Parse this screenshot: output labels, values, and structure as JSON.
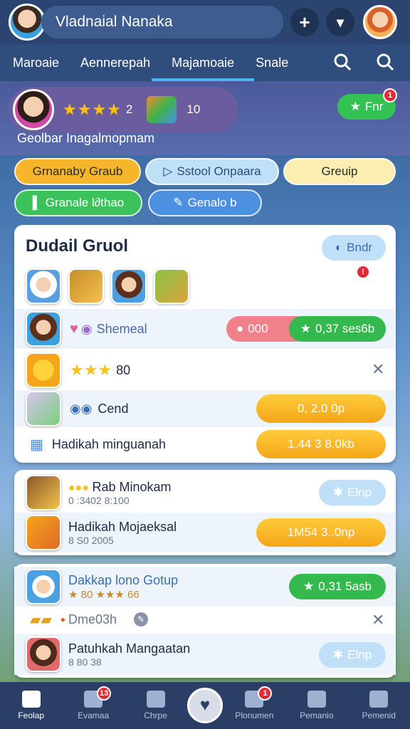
{
  "header": {
    "player_name": "Vladnaial Nanaka",
    "add_label": "+",
    "dropdown_label": "▾"
  },
  "tabs": [
    {
      "label": "Maroaie"
    },
    {
      "label": "Aennerepah"
    },
    {
      "label": "Majamoaie"
    },
    {
      "label": "Snale"
    }
  ],
  "profile_strip": {
    "stars": "★★★★",
    "star_count": "2",
    "gift_count": "10",
    "action_label": "Fnr",
    "action_badge": "1",
    "subtitle": "Geolbar Inagalmopmam"
  },
  "chips": [
    {
      "label": "Grnanaby Graub"
    },
    {
      "label": "Sstool Onpaara"
    },
    {
      "label": "Greuip"
    },
    {
      "label": "Granale l∂thao"
    },
    {
      "label": "Genalo b"
    }
  ],
  "card1": {
    "title": "Dudail Gruol",
    "title_button": "Bndr",
    "row2": {
      "text": "Shemeal",
      "pill_red": "000",
      "pill_green": "0,37 ses6b"
    },
    "row3": {
      "stars": "★★★",
      "value": "80"
    },
    "row4": {
      "text": "Cend",
      "button": "0, 2.0 0p"
    },
    "row5": {
      "text": "Hadikah minguanah",
      "button": "1.44 3 8.0kb"
    }
  },
  "card2": {
    "row1": {
      "text": "Rab Minokam",
      "sub": "0 :3402  8:100",
      "button": "Elnp"
    },
    "row2": {
      "text": "Hadikah Mojaeksal",
      "sub": "8  S0  2005",
      "button": "1M54 3..0np"
    }
  },
  "card3": {
    "row1": {
      "text": "Dakkap lono Gotup",
      "sub": "★ 80  ★★★ 66",
      "button": "0,31 5asb"
    },
    "row2": {
      "text": "Dme03h"
    },
    "row3": {
      "text": "Patuhkah Mangaatan",
      "sub": "8  80   38",
      "button": "Elnp"
    }
  },
  "bottom_nav": [
    {
      "label": "Feolap"
    },
    {
      "label": "Evamaa",
      "badge": "13"
    },
    {
      "label": "Chrpe"
    },
    {
      "label": ""
    },
    {
      "label": "Plonumen",
      "badge": "1"
    },
    {
      "label": "Pemanio"
    },
    {
      "label": "Pemenid"
    }
  ],
  "colors": {
    "green": "#33b94e",
    "orange": "#f5a51a",
    "light_blue": "#bfe0f6",
    "nav_bg": "#2b3f66"
  }
}
